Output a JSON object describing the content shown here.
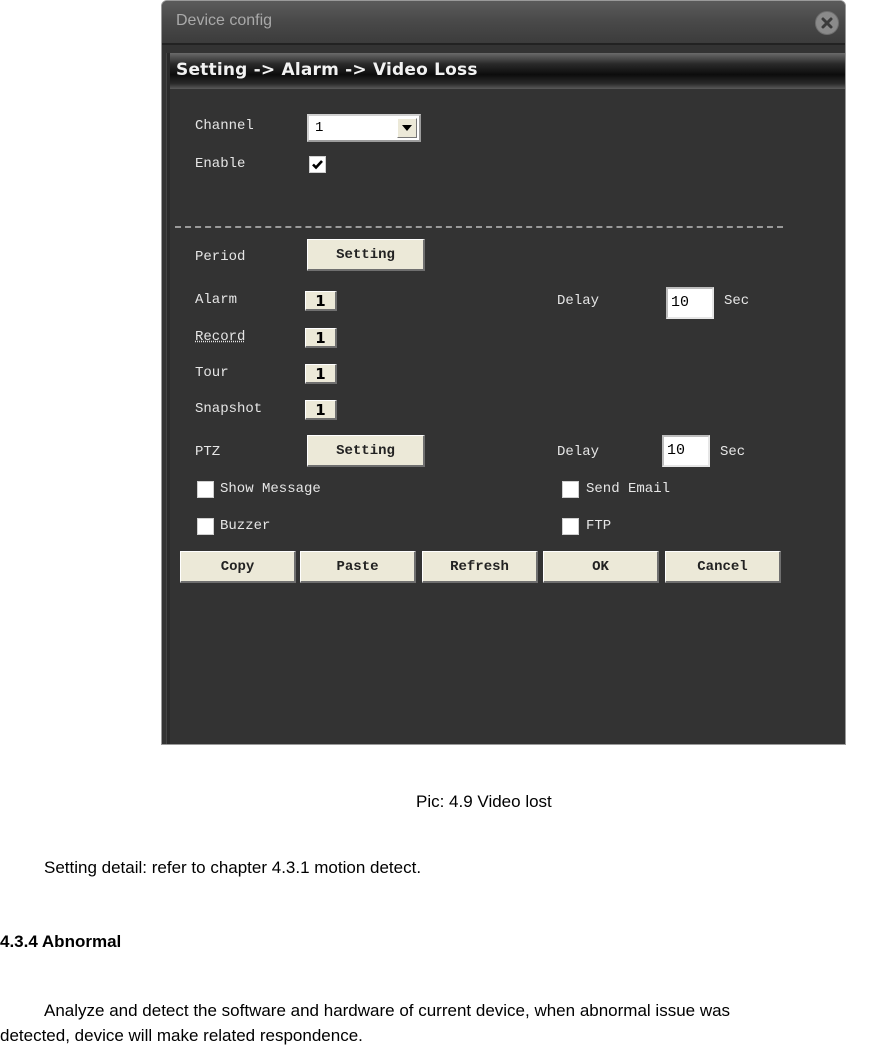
{
  "dialog": {
    "title": "Device config",
    "breadcrumb": "Setting -> Alarm -> Video Loss",
    "close_icon": "close-icon",
    "channel": {
      "label": "Channel",
      "value": "1"
    },
    "enable": {
      "label": "Enable",
      "checked": true
    },
    "period": {
      "label": "Period",
      "button": "Setting"
    },
    "alarm": {
      "label": "Alarm",
      "value": "1"
    },
    "record": {
      "label": "Record",
      "value": "1"
    },
    "tour": {
      "label": "Tour",
      "value": "1"
    },
    "snapshot": {
      "label": "Snapshot",
      "value": "1"
    },
    "delay1": {
      "label": "Delay",
      "value": "10",
      "unit": "Sec"
    },
    "ptz": {
      "label": "PTZ",
      "button": "Setting"
    },
    "delay2": {
      "label": "Delay",
      "value": "10",
      "unit": "Sec"
    },
    "checkboxes": [
      {
        "label": "Show Message",
        "checked": false
      },
      {
        "label": "Send Email",
        "checked": false
      },
      {
        "label": "Buzzer",
        "checked": false
      },
      {
        "label": "FTP",
        "checked": false
      }
    ],
    "buttons": [
      "Copy",
      "Paste",
      "Refresh",
      "OK",
      "Cancel"
    ]
  },
  "document": {
    "caption": "Pic: 4.9 Video lost",
    "setting_detail": "Setting detail: refer to chapter 4.3.1 motion detect.",
    "heading": "4.3.4 Abnormal",
    "paragraph_line1": "Analyze and detect the software and hardware of current device, when abnormal issue was",
    "paragraph_line2": "detected, device will make related respondence."
  }
}
